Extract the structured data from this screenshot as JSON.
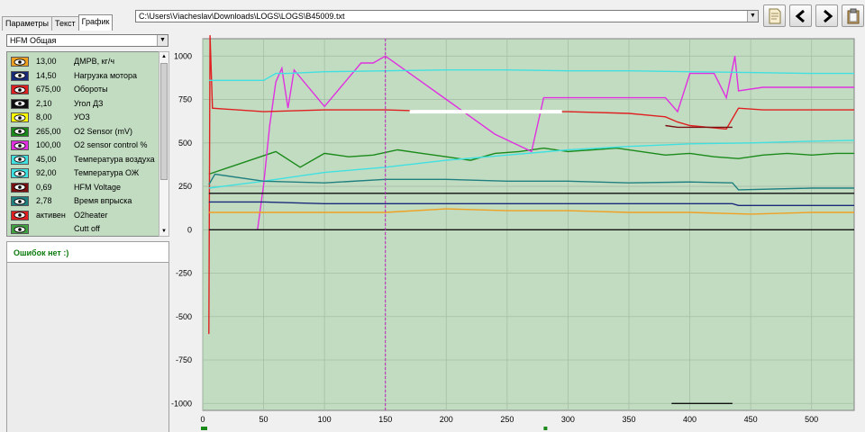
{
  "tabs": [
    {
      "label": "Параметры",
      "active": false
    },
    {
      "label": "Текст",
      "active": false
    },
    {
      "label": "График",
      "active": true
    }
  ],
  "log_path": "C:\\Users\\Viacheslav\\Downloads\\LOGS\\LOGS\\B45009.txt",
  "toolbar": {
    "buttons": [
      "document-icon",
      "arrow-left-icon",
      "arrow-right-icon",
      "clipboard-icon"
    ]
  },
  "profile_select": "HFM Общая",
  "sensors": [
    {
      "value": "13,00",
      "name": "ДМРВ, кг/ч",
      "color": "#f0a020"
    },
    {
      "value": "14,50",
      "name": "Нагрузка мотора",
      "color": "#1a2a7a"
    },
    {
      "value": "675,00",
      "name": "Обороты",
      "color": "#e02020"
    },
    {
      "value": "2,10",
      "name": "Угол ДЗ",
      "color": "#101010"
    },
    {
      "value": "8,00",
      "name": "УОЗ",
      "color": "#ffff00"
    },
    {
      "value": "265,00",
      "name": "O2 Sensor (mV)",
      "color": "#1a8a1a"
    },
    {
      "value": "100,00",
      "name": "O2 sensor control %",
      "color": "#e030e0"
    },
    {
      "value": "45,00",
      "name": "Температура воздуха",
      "color": "#40e0e0"
    },
    {
      "value": "92,00",
      "name": "Температура ОЖ",
      "color": "#40e0e0"
    },
    {
      "value": "0,69",
      "name": "HFM Voltage",
      "color": "#7a1010"
    },
    {
      "value": "2,78",
      "name": "Время впрыска",
      "color": "#208080"
    },
    {
      "value": "активен",
      "name": "O2heater",
      "color": "#e02020"
    },
    {
      "value": "",
      "name": "Cutt off",
      "color": "#40a040"
    }
  ],
  "error_text": "Ошибок нет :)",
  "colors": {
    "plot_bg": "#c2dcc2",
    "grid": "#a6bea6",
    "cursor": "#c020c0"
  },
  "chart_data": {
    "type": "line",
    "xlim": [
      0,
      535
    ],
    "ylim": [
      -1000,
      1000
    ],
    "xticks": [
      0,
      50,
      100,
      150,
      200,
      250,
      300,
      350,
      400,
      450,
      500
    ],
    "yticks": [
      1000,
      750,
      500,
      250,
      0,
      -250,
      -500,
      -750,
      -1000
    ],
    "grid": true,
    "cursor_x": 150,
    "series": [
      {
        "color": "#1a8a1a",
        "x": [
          5,
          60,
          80,
          100,
          120,
          140,
          160,
          180,
          200,
          220,
          240,
          260,
          280,
          300,
          320,
          340,
          360,
          380,
          400,
          420,
          440,
          460,
          480,
          500,
          520,
          535
        ],
        "y": [
          320,
          450,
          360,
          440,
          420,
          430,
          460,
          440,
          420,
          400,
          440,
          450,
          470,
          450,
          460,
          470,
          450,
          430,
          440,
          420,
          410,
          430,
          440,
          430,
          440,
          440
        ]
      },
      {
        "color": "#e030e0",
        "x": [
          45,
          50,
          55,
          60,
          65,
          70,
          75,
          100,
          130,
          140,
          150,
          180,
          200,
          220,
          240,
          270,
          280,
          300,
          350,
          380,
          390,
          400,
          420,
          430,
          437,
          440,
          460,
          500,
          535
        ],
        "y": [
          0,
          260,
          600,
          850,
          930,
          700,
          920,
          710,
          960,
          960,
          1000,
          850,
          750,
          650,
          550,
          450,
          760,
          760,
          760,
          760,
          680,
          900,
          900,
          760,
          1000,
          800,
          820,
          820,
          820
        ]
      },
      {
        "color": "#e02020",
        "x": [
          5,
          6,
          8,
          50,
          100,
          150,
          200,
          250,
          300,
          350,
          380,
          390,
          400,
          430,
          440,
          460,
          500,
          535
        ],
        "y": [
          -600,
          1120,
          700,
          680,
          690,
          690,
          680,
          680,
          680,
          670,
          650,
          620,
          600,
          580,
          700,
          690,
          690,
          690
        ]
      },
      {
        "color": "#40e0e0",
        "x": [
          5,
          50,
          60,
          70,
          100,
          150,
          200,
          250,
          300,
          350,
          400,
          450,
          500,
          535
        ],
        "y": [
          860,
          860,
          900,
          900,
          910,
          915,
          920,
          920,
          915,
          915,
          910,
          905,
          900,
          900
        ]
      },
      {
        "color": "#40e0e0",
        "x": [
          5,
          50,
          100,
          150,
          200,
          250,
          300,
          350,
          400,
          450,
          500,
          535
        ],
        "y": [
          240,
          280,
          330,
          360,
          400,
          430,
          460,
          480,
          495,
          500,
          510,
          515
        ]
      },
      {
        "color": "#208080",
        "x": [
          5,
          10,
          50,
          100,
          150,
          200,
          250,
          300,
          350,
          400,
          435,
          440,
          500,
          535
        ],
        "y": [
          260,
          320,
          280,
          270,
          290,
          290,
          280,
          280,
          270,
          275,
          270,
          230,
          240,
          240
        ]
      },
      {
        "color": "#1a2a7a",
        "x": [
          5,
          50,
          100,
          150,
          200,
          250,
          300,
          350,
          400,
          435,
          440,
          535
        ],
        "y": [
          160,
          160,
          150,
          150,
          150,
          150,
          150,
          150,
          150,
          150,
          140,
          140
        ]
      },
      {
        "color": "#101010",
        "x": [
          5,
          100,
          200,
          300,
          400,
          535
        ],
        "y": [
          210,
          210,
          210,
          210,
          210,
          210
        ]
      },
      {
        "color": "#101010",
        "x": [
          5,
          100,
          200,
          300,
          400,
          535
        ],
        "y": [
          0,
          0,
          0,
          0,
          0,
          0
        ]
      },
      {
        "color": "#f0a020",
        "x": [
          5,
          150,
          200,
          250,
          300,
          350,
          400,
          450,
          500,
          535
        ],
        "y": [
          100,
          100,
          120,
          110,
          110,
          100,
          100,
          90,
          100,
          100
        ]
      },
      {
        "color": "#7a1010",
        "x": [
          380,
          390,
          400,
          430,
          435
        ],
        "y": [
          600,
          590,
          590,
          590,
          590
        ]
      },
      {
        "color": "#101010",
        "x": [
          385,
          435
        ],
        "y": [
          -1000,
          -1000
        ]
      },
      {
        "color": "#ffffff",
        "x": [
          170,
          295
        ],
        "y": [
          680,
          680
        ]
      }
    ]
  }
}
